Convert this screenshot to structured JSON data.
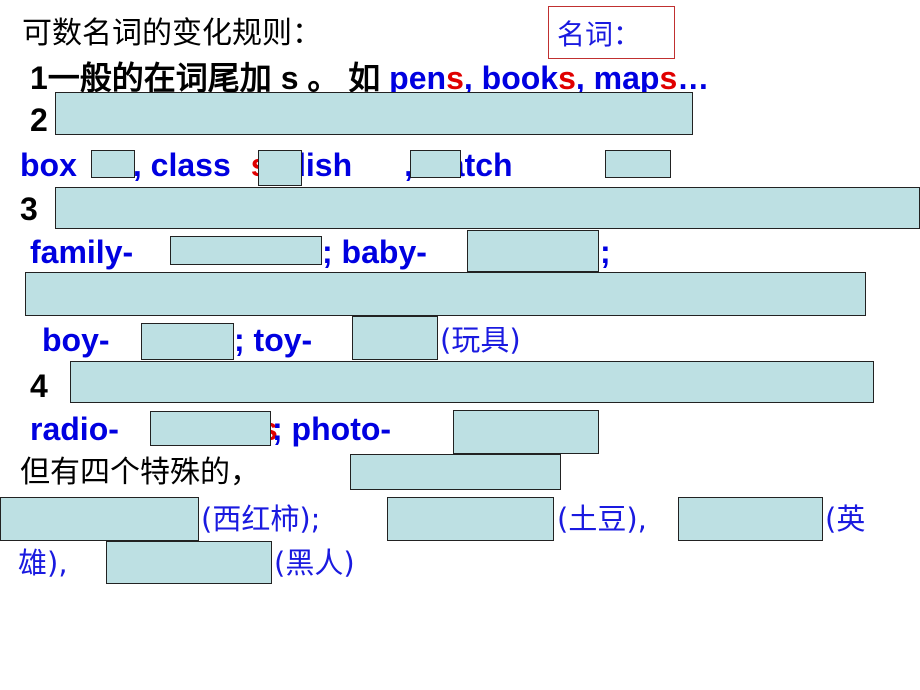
{
  "title": "可数名词的变化规则：",
  "tag_label": "名词：",
  "rule1": {
    "prefix": "1一般的在词尾加 s 。 如 ",
    "ex1_stem": "pens",
    "ex1_s": "",
    "w1": "pen",
    "s": "s",
    "w2": "book",
    "w3": "map",
    "sep": ", ",
    "ellipsis": "…"
  },
  "rule2": {
    "num": "2"
  },
  "rule2_examples": {
    "box": "box",
    "class": ", class",
    "class_end": "s",
    "dish": ", dish",
    "watch": ",  watch"
  },
  "rule3": {
    "num": "3",
    "family": "family-",
    "baby": "; baby-",
    "semicolon": ";",
    "boy": "boy-",
    "toy": ";  toy-",
    "toy_cn": "(玩具)"
  },
  "rule4": {
    "num": "4",
    "radio": "radio-",
    "radio_end": "s",
    "photo": ";  photo-"
  },
  "special": {
    "intro": "但有四个特殊的，",
    "tomato_cn": "(西红柿);",
    "potato_cn": "(土豆),",
    "hero_cn_a": "(英",
    "hero_cn_b": "雄),",
    "negro_cn": "(黑人)"
  },
  "colors": {
    "mask": "#bde0e3",
    "blue": "#0000e0",
    "red": "#e00000"
  }
}
